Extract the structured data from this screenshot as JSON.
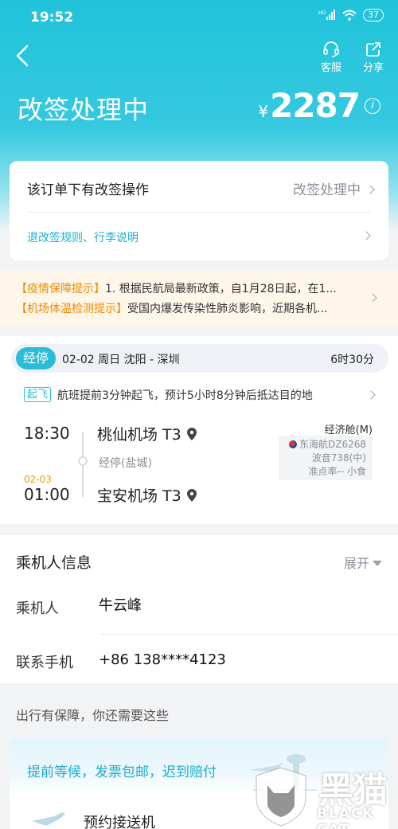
{
  "status_bar": {
    "time": "19:52",
    "battery": "37"
  },
  "header": {
    "title": "改签处理中",
    "currency": "¥",
    "price": "2287",
    "info_symbol": "i",
    "actions": [
      {
        "label": "客服",
        "icon": "headset-icon"
      },
      {
        "label": "分享",
        "icon": "share-icon"
      }
    ]
  },
  "order": {
    "notice": "该订单下有改签操作",
    "status": "改签处理中",
    "rules_link": "退改签规则、行李说明"
  },
  "notices": [
    {
      "tag": "【疫情保障提示】",
      "text": "1. 根据民航局最新政策，自1月28日起，在1..."
    },
    {
      "tag": "【机场体温检测提示】",
      "text": "受国内爆发传染性肺炎影响，近期各机..."
    }
  ],
  "flight": {
    "badge": "经停",
    "date": "02-02 周日 沈阳 - 深圳",
    "duration": "6时30分",
    "takeoff_tag": "起飞",
    "takeoff_text": "航班提前3分钟起飞，预计5小时8分钟后抵达目的地",
    "departure_time": "18:30",
    "departure_airport": "桃仙机场 T3",
    "stop": "经停(盐城)",
    "arrival_date": "02-03",
    "arrival_time": "01:00",
    "arrival_airport": "宝安机场 T3",
    "cabin": "经济舱(M)",
    "airline": "东海航DZ6268",
    "aircraft": "波音738(中)",
    "punctuality": "准点率-- 小食"
  },
  "passenger": {
    "section_title": "乘机人信息",
    "expand_label": "展开",
    "passenger_label": "乘机人",
    "passenger_name": "牛云峰",
    "phone_label": "联系手机",
    "phone": "+86 138****4123"
  },
  "guarantee": {
    "title": "出行有保障，你还需要这些",
    "promo": "提前等候，发票包邮，迟到赔付",
    "item": "预约接送机"
  },
  "watermark": {
    "cn": "黑猫",
    "en": "BLACK CAT"
  },
  "colors": {
    "header": "#1fc3da",
    "accent": "#1aaed0",
    "notice_tag": "#f08a00",
    "arrival_date": "#e89a1a"
  }
}
